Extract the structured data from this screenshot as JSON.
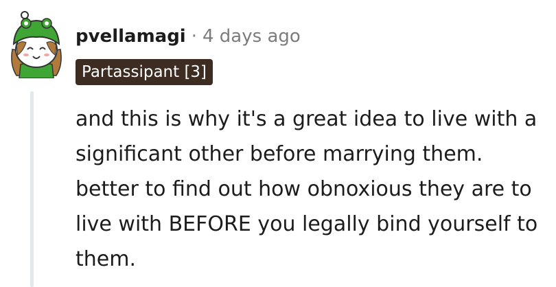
{
  "comment": {
    "author": "pvellamagi",
    "separator": "·",
    "timestamp": "4 days ago",
    "flair": "Partassipant [3]",
    "body": "and this is why it's a great idea to live with a significant other before marrying them. better to find out how obnoxious they are to live with BEFORE you legally bind yourself to them."
  },
  "avatar": {
    "icon": "snoo-avatar-icon",
    "hat_color": "#3fa535",
    "hair_color": "#b07a3c"
  },
  "colors": {
    "flair_background": "#3d2c22",
    "meta_text": "#7c7c7c",
    "body_text": "#1c1c1c",
    "thread_line": "#e5e8eb"
  }
}
